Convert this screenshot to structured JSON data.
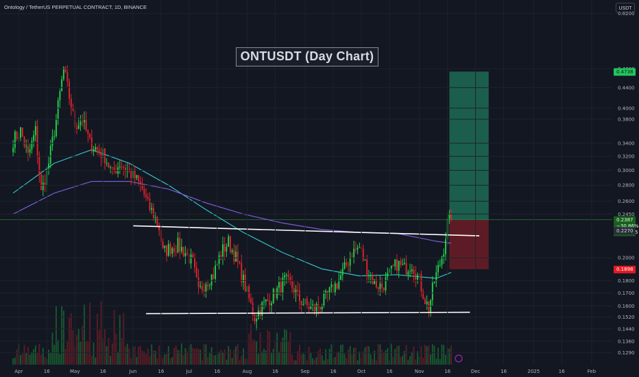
{
  "header": {
    "symbol_line": "Ontology / TetherUS PERPETUAL CONTRACT, 1D, BINANCE",
    "unit": "USDT"
  },
  "title_box": "ONTUSDT (Day Chart)",
  "colors": {
    "background": "#131722",
    "up": "#22d34a",
    "down": "#e3242b",
    "ma_short": "#34c3c8",
    "ma_long": "#7b5cd6",
    "target_zone": "#1e6b55",
    "stop_zone": "#6b1d26",
    "price_line": "#26a69a"
  },
  "chart_data": {
    "type": "candlestick",
    "title": "ONTUSDT (Day Chart)",
    "y_scale": "log",
    "ylim": [
      0.122,
      0.66
    ],
    "y_ticks": [
      "0.6200",
      "0.4800",
      "0.4400",
      "0.4000",
      "0.3800",
      "0.3400",
      "0.3200",
      "0.3000",
      "0.2800",
      "0.2600",
      "0.2450",
      "0.2000",
      "0.1800",
      "0.1700",
      "0.1600",
      "0.1520",
      "0.1440",
      "0.1360",
      "0.1290"
    ],
    "x_ticks": [
      {
        "label": "Apr",
        "date": "2024-04-01"
      },
      {
        "label": "16",
        "date": "2024-04-16"
      },
      {
        "label": "May",
        "date": "2024-05-01"
      },
      {
        "label": "16",
        "date": "2024-05-16"
      },
      {
        "label": "Jun",
        "date": "2024-06-01"
      },
      {
        "label": "16",
        "date": "2024-06-16"
      },
      {
        "label": "Jul",
        "date": "2024-07-01"
      },
      {
        "label": "16",
        "date": "2024-07-16"
      },
      {
        "label": "Aug",
        "date": "2024-08-01"
      },
      {
        "label": "16",
        "date": "2024-08-16"
      },
      {
        "label": "Sep",
        "date": "2024-09-01"
      },
      {
        "label": "16",
        "date": "2024-09-16"
      },
      {
        "label": "Oct",
        "date": "2024-10-01"
      },
      {
        "label": "16",
        "date": "2024-10-16"
      },
      {
        "label": "Nov",
        "date": "2024-11-01"
      },
      {
        "label": "16",
        "date": "2024-11-16"
      },
      {
        "label": "Dec",
        "date": "2024-12-01"
      },
      {
        "label": "16",
        "date": "2024-12-16"
      },
      {
        "label": "2025",
        "date": "2025-01-01"
      },
      {
        "label": "16",
        "date": "2025-01-16"
      },
      {
        "label": "Feb",
        "date": "2025-02-01"
      }
    ],
    "price_path": [
      [
        "2024-03-29",
        0.345
      ],
      [
        "2024-04-02",
        0.36
      ],
      [
        "2024-04-06",
        0.32
      ],
      [
        "2024-04-10",
        0.36
      ],
      [
        "2024-04-13",
        0.27
      ],
      [
        "2024-04-17",
        0.31
      ],
      [
        "2024-04-21",
        0.38
      ],
      [
        "2024-04-25",
        0.48
      ],
      [
        "2024-04-27",
        0.44
      ],
      [
        "2024-05-01",
        0.37
      ],
      [
        "2024-05-05",
        0.38
      ],
      [
        "2024-05-09",
        0.34
      ],
      [
        "2024-05-13",
        0.33
      ],
      [
        "2024-05-17",
        0.32
      ],
      [
        "2024-05-21",
        0.295
      ],
      [
        "2024-05-25",
        0.31
      ],
      [
        "2024-05-29",
        0.3
      ],
      [
        "2024-06-02",
        0.29
      ],
      [
        "2024-06-06",
        0.275
      ],
      [
        "2024-06-09",
        0.255
      ],
      [
        "2024-06-12",
        0.245
      ],
      [
        "2024-06-15",
        0.23
      ],
      [
        "2024-06-17",
        0.205
      ],
      [
        "2024-06-21",
        0.21
      ],
      [
        "2024-06-25",
        0.212
      ],
      [
        "2024-06-29",
        0.205
      ],
      [
        "2024-07-03",
        0.195
      ],
      [
        "2024-07-06",
        0.17
      ],
      [
        "2024-07-10",
        0.18
      ],
      [
        "2024-07-14",
        0.185
      ],
      [
        "2024-07-18",
        0.205
      ],
      [
        "2024-07-22",
        0.215
      ],
      [
        "2024-07-26",
        0.2
      ],
      [
        "2024-07-30",
        0.18
      ],
      [
        "2024-08-02",
        0.165
      ],
      [
        "2024-08-05",
        0.152
      ],
      [
        "2024-08-09",
        0.16
      ],
      [
        "2024-08-13",
        0.165
      ],
      [
        "2024-08-17",
        0.172
      ],
      [
        "2024-08-21",
        0.18
      ],
      [
        "2024-08-25",
        0.175
      ],
      [
        "2024-08-29",
        0.165
      ],
      [
        "2024-09-02",
        0.16
      ],
      [
        "2024-09-06",
        0.158
      ],
      [
        "2024-09-10",
        0.162
      ],
      [
        "2024-09-14",
        0.17
      ],
      [
        "2024-09-18",
        0.178
      ],
      [
        "2024-09-22",
        0.19
      ],
      [
        "2024-09-26",
        0.205
      ],
      [
        "2024-09-30",
        0.21
      ],
      [
        "2024-10-04",
        0.19
      ],
      [
        "2024-10-08",
        0.178
      ],
      [
        "2024-10-12",
        0.175
      ],
      [
        "2024-10-16",
        0.185
      ],
      [
        "2024-10-20",
        0.195
      ],
      [
        "2024-10-24",
        0.19
      ],
      [
        "2024-10-28",
        0.195
      ],
      [
        "2024-11-01",
        0.18
      ],
      [
        "2024-11-04",
        0.165
      ],
      [
        "2024-11-06",
        0.158
      ],
      [
        "2024-11-09",
        0.18
      ],
      [
        "2024-11-12",
        0.195
      ],
      [
        "2024-11-14",
        0.21
      ],
      [
        "2024-11-16",
        0.235
      ],
      [
        "2024-11-18",
        0.2387
      ]
    ],
    "moving_averages": [
      {
        "color": "#34c3c8",
        "points": [
          [
            "2024-03-29",
            0.27
          ],
          [
            "2024-04-20",
            0.31
          ],
          [
            "2024-05-10",
            0.33
          ],
          [
            "2024-05-30",
            0.31
          ],
          [
            "2024-06-20",
            0.28
          ],
          [
            "2024-07-10",
            0.25
          ],
          [
            "2024-07-30",
            0.225
          ],
          [
            "2024-08-20",
            0.205
          ],
          [
            "2024-09-10",
            0.19
          ],
          [
            "2024-09-30",
            0.184
          ],
          [
            "2024-10-20",
            0.185
          ],
          [
            "2024-11-10",
            0.182
          ],
          [
            "2024-11-18",
            0.187
          ]
        ]
      },
      {
        "color": "#7b5cd6",
        "points": [
          [
            "2024-03-29",
            0.245
          ],
          [
            "2024-04-20",
            0.27
          ],
          [
            "2024-05-10",
            0.285
          ],
          [
            "2024-05-30",
            0.285
          ],
          [
            "2024-06-20",
            0.275
          ],
          [
            "2024-07-10",
            0.258
          ],
          [
            "2024-07-30",
            0.245
          ],
          [
            "2024-08-20",
            0.235
          ],
          [
            "2024-09-10",
            0.228
          ],
          [
            "2024-09-30",
            0.225
          ],
          [
            "2024-10-20",
            0.224
          ],
          [
            "2024-11-10",
            0.216
          ],
          [
            "2024-11-18",
            0.214
          ]
        ]
      }
    ],
    "trendlines": [
      {
        "x": [
          "2024-06-01",
          "2024-12-03"
        ],
        "y": [
          0.232,
          0.2215
        ]
      },
      {
        "x": [
          "2024-06-08",
          "2024-11-28"
        ],
        "y": [
          0.1545,
          0.1555
        ]
      }
    ],
    "position": {
      "entry": 0.2385,
      "target": 0.4738,
      "stop": 0.1898,
      "x_start": "2024-11-17",
      "x_end": "2024-12-08"
    },
    "price_tags": [
      {
        "text": "0.4738",
        "y": 0.4738,
        "kind": "target"
      },
      {
        "text": "0.2387",
        "y": 0.2387,
        "kind": "current",
        "lines": [
          "0.2387",
          "−30.86%",
          "06:44:55"
        ]
      },
      {
        "text": "0.2270",
        "y": 0.227,
        "kind": "level"
      },
      {
        "text": "0.1898",
        "y": 0.1898,
        "kind": "stop"
      }
    ]
  }
}
